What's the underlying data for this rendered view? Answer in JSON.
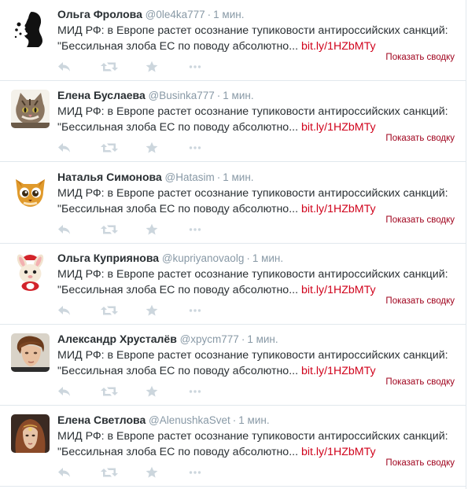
{
  "tweets": [
    {
      "name": "Ольга Фролова",
      "handle": "@0le4ka777",
      "separator": "·",
      "time": "1 мин.",
      "text_line1": "МИД РФ: в Европе растет осознание тупиковости антироссийских санкций:",
      "text_line2": "\"Бессильная злоба ЕС по поводу абсолютно...",
      "link": "bit.ly/1HZbMTy",
      "summary": "Показать сводку",
      "avatar_icon": "woman-silhouette-avatar"
    },
    {
      "name": "Елена Буслаева",
      "handle": "@Businka777",
      "separator": "·",
      "time": "1 мин.",
      "text_line1": "МИД РФ: в Европе растет осознание тупиковости антироссийских санкций:",
      "text_line2": "\"Бессильная злоба ЕС по поводу абсолютно...",
      "link": "bit.ly/1HZbMTy",
      "summary": "Показать сводку",
      "avatar_icon": "cat-avatar"
    },
    {
      "name": "Наталья Симонова",
      "handle": "@Hatasim",
      "separator": "·",
      "time": "1 мин.",
      "text_line1": "МИД РФ: в Европе растет осознание тупиковости антироссийских санкций:",
      "text_line2": "\"Бессильная злоба ЕС по поводу абсолютно...",
      "link": "bit.ly/1HZbMTy",
      "summary": "Показать сводку",
      "avatar_icon": "cartoon-cat-avatar"
    },
    {
      "name": "Ольга Куприянова",
      "handle": "@kupriyanovaolg",
      "separator": "·",
      "time": "1 мин.",
      "text_line1": "МИД РФ: в Европе растет осознание тупиковости антироссийских санкций:",
      "text_line2": "\"Бессильная злоба ЕС по поводу абсолютно...",
      "link": "bit.ly/1HZbMTy",
      "summary": "Показать сводку",
      "avatar_icon": "bunny-toy-avatar"
    },
    {
      "name": "Александр Хрусталёв",
      "handle": "@xpycm777",
      "separator": "·",
      "time": "1 мин.",
      "text_line1": "МИД РФ: в Европе растет осознание тупиковости антироссийских санкций:",
      "text_line2": "\"Бессильная злоба ЕС по поводу абсолютно...",
      "link": "bit.ly/1HZbMTy",
      "summary": "Показать сводку",
      "avatar_icon": "young-man-avatar"
    },
    {
      "name": "Елена Светлова",
      "handle": "@AlenushkaSvet",
      "separator": "·",
      "time": "1 мин.",
      "text_line1": "МИД РФ: в Европе растет осознание тупиковости антироссийских санкций:",
      "text_line2": "\"Бессильная злоба ЕС по поводу абсолютно...",
      "link": "bit.ly/1HZbMTy",
      "summary": "Показать сводку",
      "avatar_icon": "woman-portrait-avatar"
    }
  ],
  "colors": {
    "link": "#d0021b",
    "summary": "#a0041e",
    "muted": "#8899a6",
    "action_icon": "#ccd6dd",
    "divider": "#e1e8ed"
  },
  "actions": [
    "reply-icon",
    "retweet-icon",
    "favorite-icon",
    "more-icon"
  ]
}
